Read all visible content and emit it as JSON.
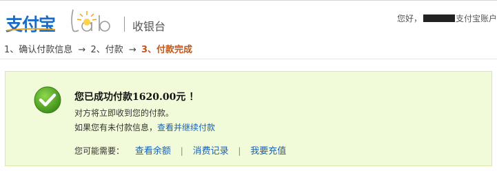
{
  "header": {
    "brand": "支付宝",
    "lab_text": "lab",
    "sub_title": "收银台",
    "greeting_prefix": "您好，",
    "greeting_suffix": "支付宝账户"
  },
  "steps": {
    "step1": "1、确认付款信息",
    "arrow1": "→",
    "step2": "2、付款",
    "arrow2": "→",
    "step3": "3、付款完成"
  },
  "result": {
    "title": "您已成功付款1620.00元 ！",
    "line1": "对方将立即收到您的付款。",
    "line2_prefix": "如果您有未付款信息，",
    "line2_link": "查看并继续付款",
    "need_label": "您可能需要：",
    "links": [
      "查看余额",
      "消费记录",
      "我要充值"
    ],
    "separator": "|"
  },
  "colors": {
    "brand_blue": "#1a6bc6",
    "current_step": "#c0571b",
    "success_bg": "#f2fbd9",
    "success_border": "#d7e9a6",
    "link": "#1760b5",
    "check_green": "#4ea321"
  },
  "icons": {
    "success": "check-circle-icon"
  }
}
